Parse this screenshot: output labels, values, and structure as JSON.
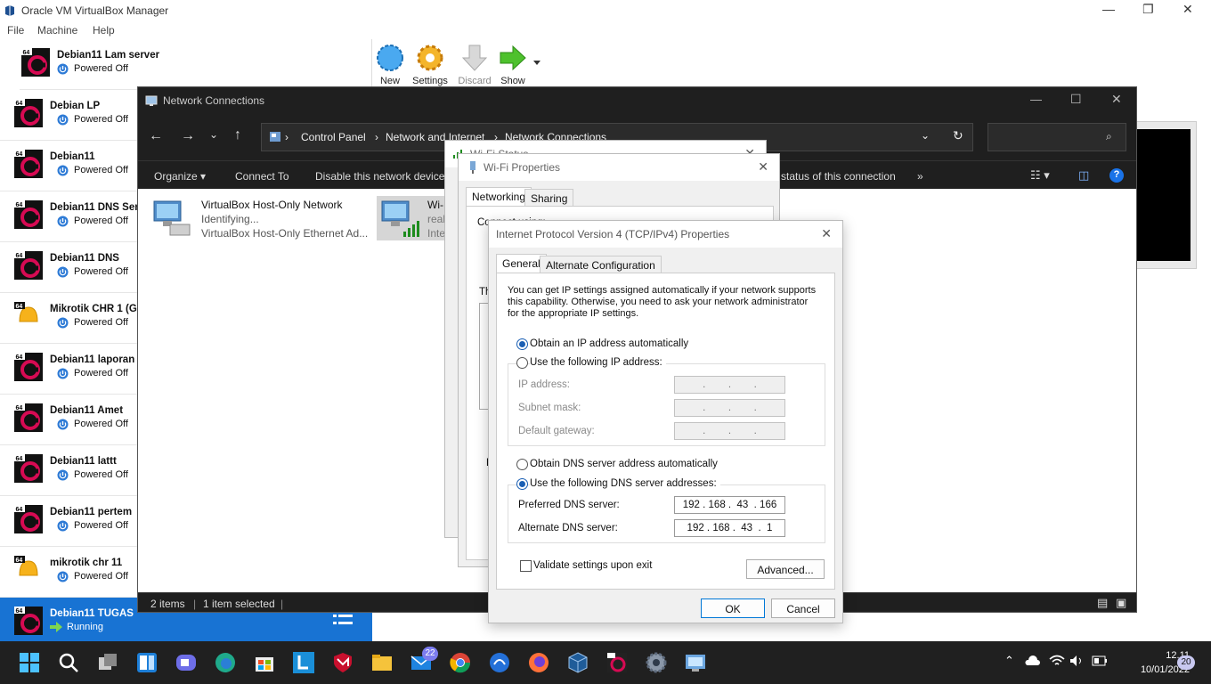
{
  "vbox": {
    "title": "Oracle VM VirtualBox Manager",
    "menu": [
      "File",
      "Machine",
      "Help"
    ],
    "window_controls": {
      "minimize": "—",
      "maximize": "❐",
      "close": "✕"
    },
    "tools": [
      {
        "label": "New",
        "icon": "new-star-icon"
      },
      {
        "label": "Settings",
        "icon": "settings-gear-icon"
      },
      {
        "label": "Discard",
        "icon": "discard-arrow-icon"
      },
      {
        "label": "Show",
        "icon": "show-arrow-icon"
      }
    ],
    "vms": [
      {
        "name": "Debian11 Lam server",
        "state": "Powered Off",
        "os": "debian"
      },
      {
        "name": "Debian LP",
        "state": "Powered Off",
        "os": "debian"
      },
      {
        "name": "Debian11",
        "state": "Powered Off",
        "os": "debian"
      },
      {
        "name": "Debian11 DNS Ser",
        "state": "Powered Off",
        "os": "debian"
      },
      {
        "name": "Debian11 DNS",
        "state": "Powered Off",
        "os": "debian"
      },
      {
        "name": "Mikrotik CHR 1 (G",
        "state": "Powered Off",
        "os": "mikrotik"
      },
      {
        "name": "Debian11 laporan",
        "state": "Powered Off",
        "os": "debian"
      },
      {
        "name": "Debian11 Amet",
        "state": "Powered Off",
        "os": "debian"
      },
      {
        "name": "Debian11 lattt",
        "state": "Powered Off",
        "os": "debian"
      },
      {
        "name": "Debian11 pertem",
        "state": "Powered Off",
        "os": "debian"
      },
      {
        "name": "mikrotik chr 11",
        "state": "Powered Off",
        "os": "mikrotik"
      },
      {
        "name": "Debian11 TUGAS",
        "state": "Running",
        "os": "debian"
      }
    ],
    "os_badge": "64"
  },
  "netconn": {
    "title": "Network Connections",
    "breadcrumb": [
      "Control Panel",
      "Network and Internet",
      "Network Connections"
    ],
    "breadcrumb_sep": "›",
    "commands": [
      "Organize ▾",
      "Connect To",
      "Disable this network device",
      "status of this connection",
      "»"
    ],
    "connections": [
      {
        "name": "VirtualBox Host-Only Network",
        "status": "Identifying...",
        "device": "VirtualBox Host-Only Ethernet Ad..."
      },
      {
        "name": "Wi-",
        "status": "real",
        "device": "Inte"
      }
    ],
    "status_bar": {
      "items": "2 items",
      "selected": "1 item selected"
    }
  },
  "wifi_status": {
    "title": "Wi-Fi Status"
  },
  "wifi_props": {
    "title": "Wi-Fi Properties",
    "tabs": [
      "Networking",
      "Sharing"
    ],
    "connect_using": "Connect using:",
    "this_label": "Th",
    "d_label": "D"
  },
  "ipv4": {
    "title": "Internet Protocol Version 4 (TCP/IPv4) Properties",
    "tabs": [
      "General",
      "Alternate Configuration"
    ],
    "description": [
      "You can get IP settings assigned automatically if your network supports",
      "this capability. Otherwise, you need to ask your network administrator",
      "for the appropriate IP settings."
    ],
    "ip_auto": "Obtain an IP address automatically",
    "ip_manual": "Use the following IP address:",
    "ip_address_label": "IP address:",
    "subnet_label": "Subnet mask:",
    "gateway_label": "Default gateway:",
    "empty_ip": ".        .        .",
    "dns_auto": "Obtain DNS server address automatically",
    "dns_manual": "Use the following DNS server addresses:",
    "preferred_label": "Preferred DNS server:",
    "preferred_value": "192 . 168 .  43  . 166",
    "alternate_label": "Alternate DNS server:",
    "alternate_value": "192 . 168 .  43  .  1",
    "validate": "Validate settings upon exit",
    "advanced": "Advanced...",
    "ok": "OK",
    "cancel": "Cancel"
  },
  "taskbar": {
    "mail_badge": "22",
    "time": "12.11",
    "date": "10/01/2022",
    "notif": "20"
  }
}
